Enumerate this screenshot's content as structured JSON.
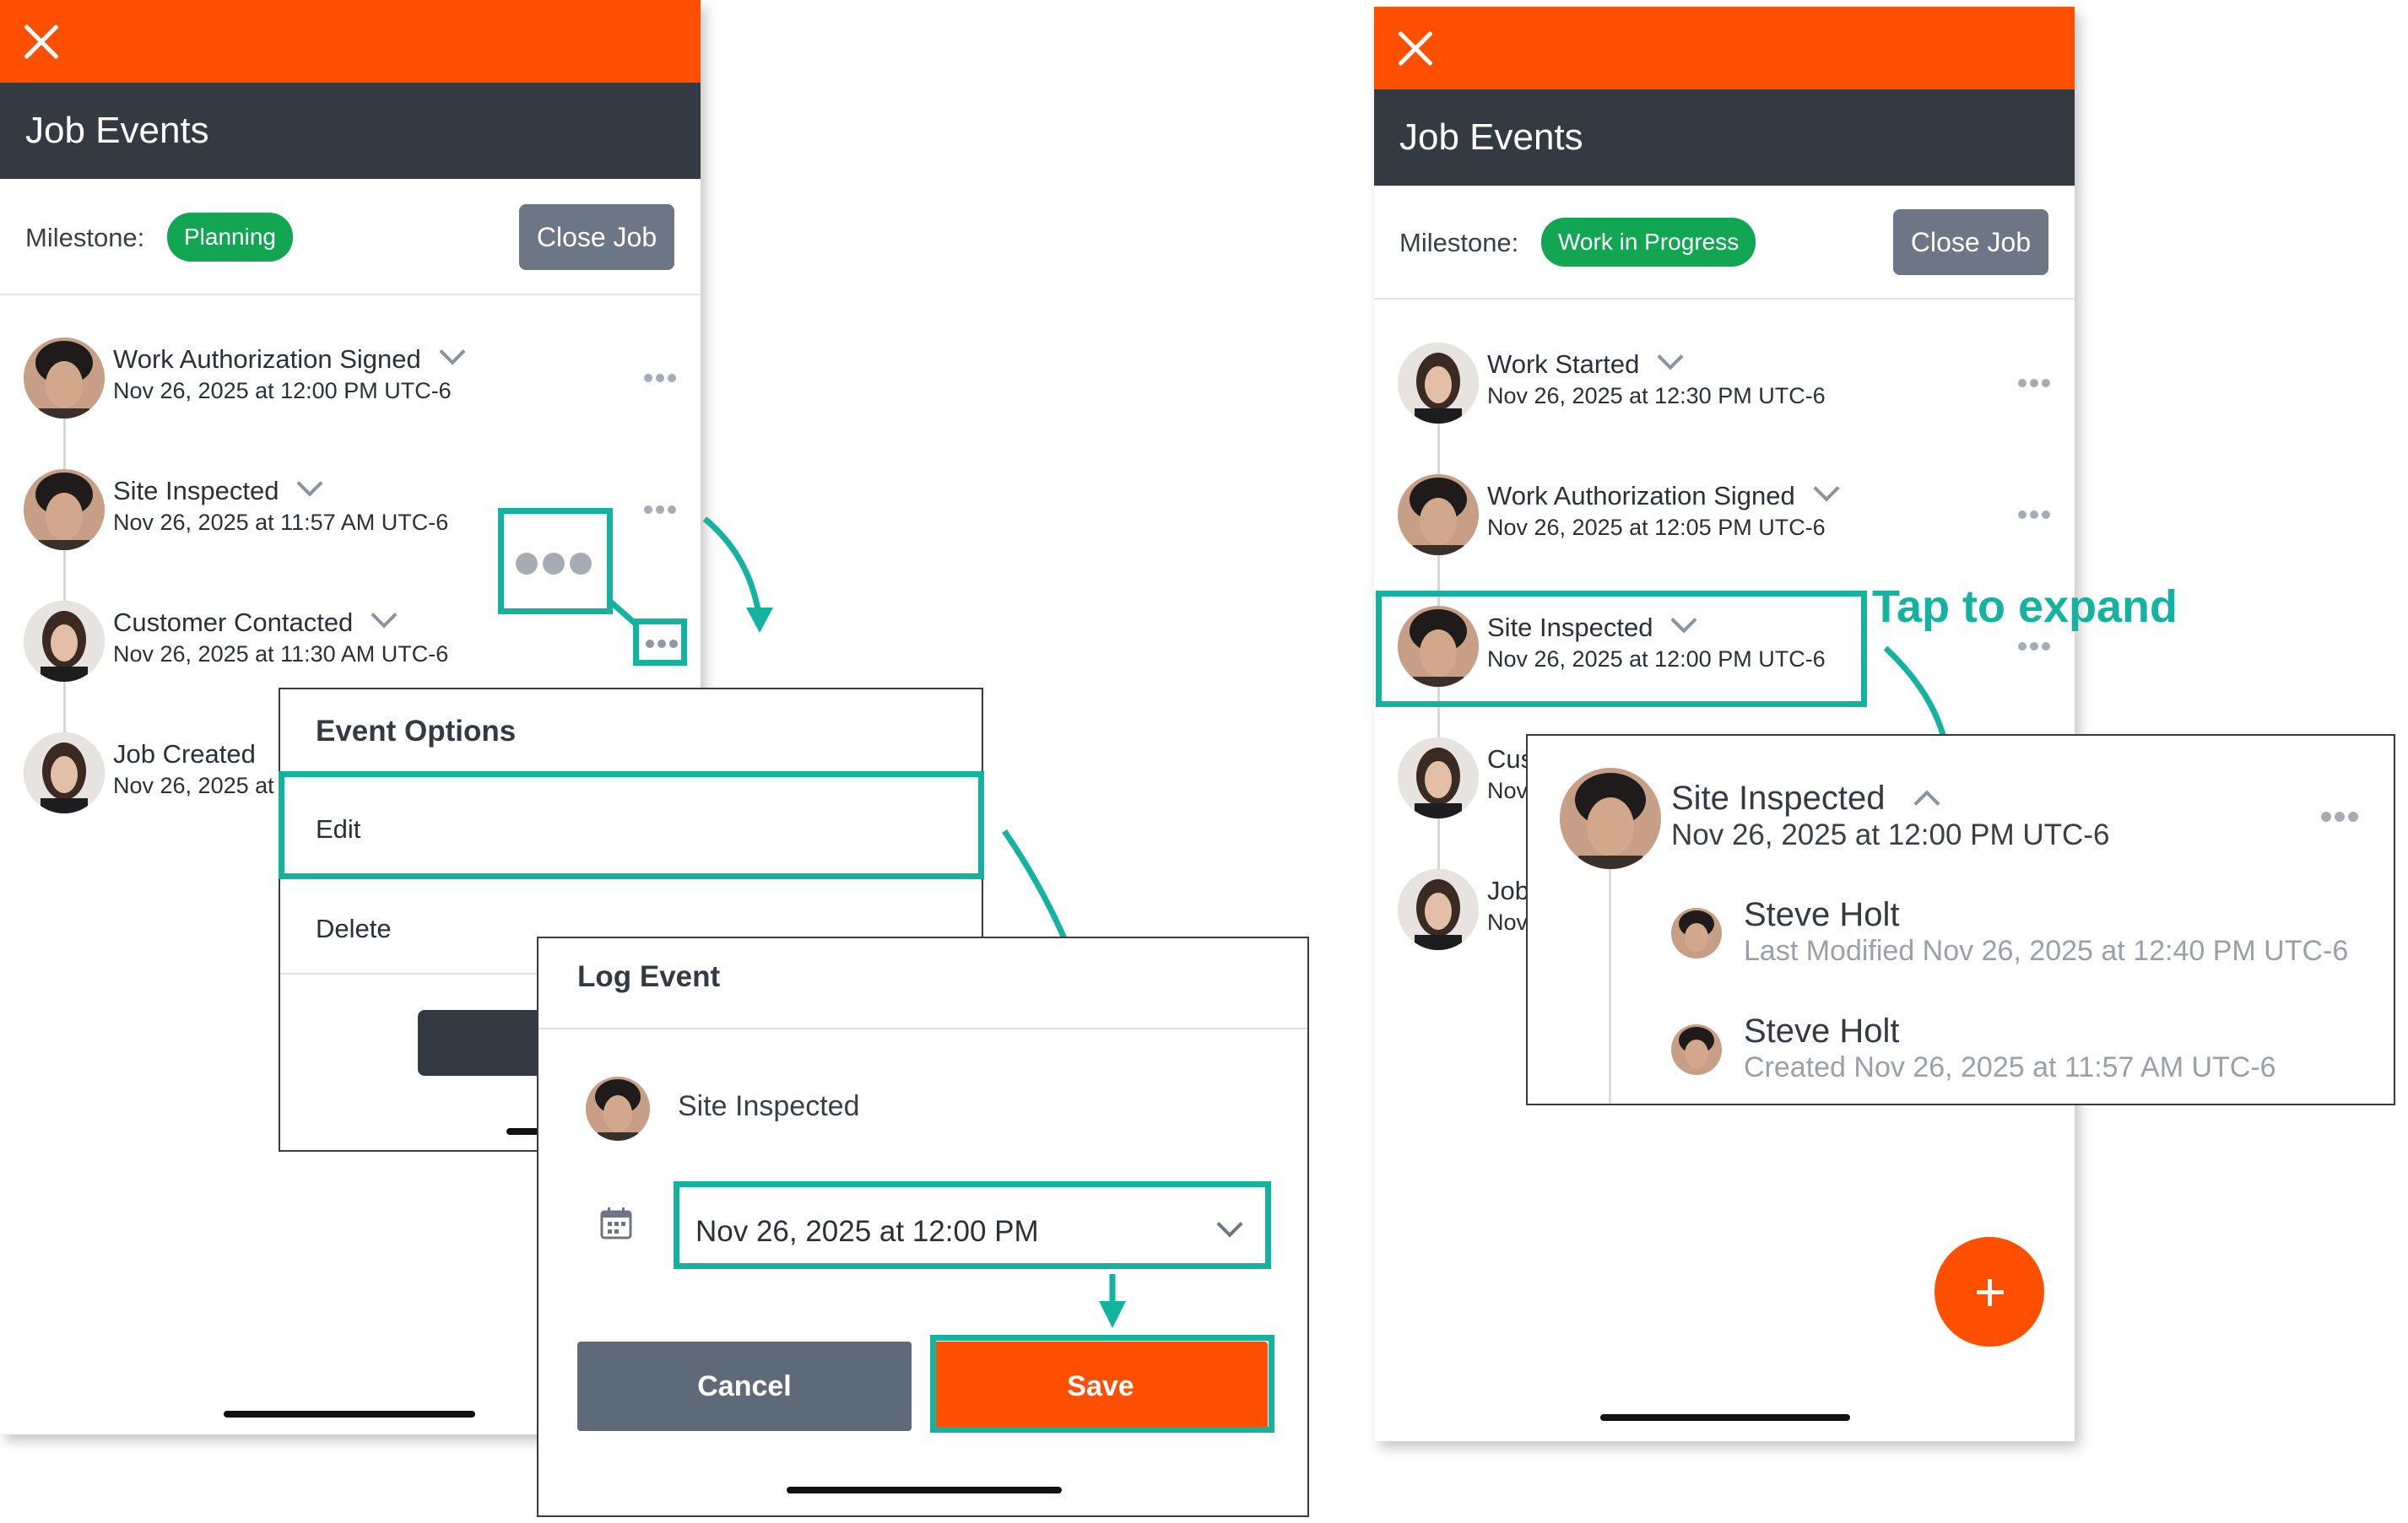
{
  "left_screen": {
    "title": "Job Events",
    "milestone_label": "Milestone:",
    "milestone_badge": "Planning",
    "close_job_label": "Close Job",
    "events": [
      {
        "title": "Work Authorization Signed",
        "date": "Nov 26, 2025 at 12:00 PM UTC-6"
      },
      {
        "title": "Site Inspected",
        "date": "Nov 26, 2025 at 11:57 AM UTC-6"
      },
      {
        "title": "Customer Contacted",
        "date": "Nov 26, 2025 at 11:30 AM UTC-6"
      },
      {
        "title": "Job Created",
        "date": "Nov 26, 2025 at"
      }
    ]
  },
  "event_options": {
    "title": "Event Options",
    "items": [
      "Edit",
      "Delete"
    ]
  },
  "log_event": {
    "title": "Log Event",
    "event_name": "Site Inspected",
    "date_value": "Nov 26, 2025 at 12:00 PM",
    "cancel_label": "Cancel",
    "save_label": "Save"
  },
  "right_screen": {
    "title": "Job Events",
    "milestone_label": "Milestone:",
    "milestone_badge": "Work in Progress",
    "close_job_label": "Close Job",
    "events": [
      {
        "title": "Work Started",
        "date": "Nov 26, 2025 at 12:30 PM UTC-6"
      },
      {
        "title": "Work Authorization Signed",
        "date": "Nov 26, 2025 at 12:05 PM UTC-6"
      },
      {
        "title": "Site Inspected",
        "date": "Nov 26, 2025 at 12:00 PM UTC-6"
      },
      {
        "title": "Cus",
        "date": "Nov"
      },
      {
        "title": "Job",
        "date": "Nov"
      }
    ],
    "fab_icon": "plus-icon"
  },
  "expanded_event": {
    "title": "Site Inspected",
    "date": "Nov 26, 2025 at 12:00 PM UTC-6",
    "history": [
      {
        "name": "Steve Holt",
        "detail": "Last Modified Nov 26, 2025 at 12:40 PM UTC-6"
      },
      {
        "name": "Steve Holt",
        "detail": "Created Nov 26, 2025 at 11:57 AM UTC-6"
      }
    ]
  },
  "annotation": {
    "tap_to_expand": "Tap to expand"
  },
  "colors": {
    "brand_orange": "#ff4f00",
    "header_dark": "#343a42",
    "badge_green": "#12a552",
    "highlight_teal": "#14b3a0",
    "button_gray": "#6c7685"
  }
}
